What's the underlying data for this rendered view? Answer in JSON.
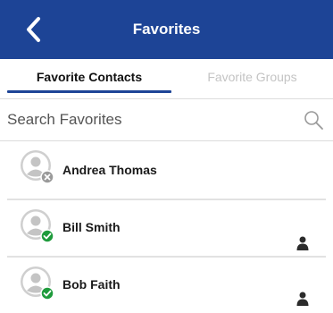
{
  "header": {
    "title": "Favorites",
    "back_icon": "chevron-left-icon"
  },
  "tabs": [
    {
      "label": "Favorite Contacts",
      "active": true
    },
    {
      "label": "Favorite Groups",
      "active": false
    }
  ],
  "search": {
    "placeholder": "Search Favorites",
    "value": ""
  },
  "contacts": [
    {
      "name": "Andrea Thomas",
      "status": "offline",
      "status_icon": "offline-x-icon",
      "show_person_icon": false
    },
    {
      "name": "Bill Smith",
      "status": "online",
      "status_icon": "online-check-icon",
      "show_person_icon": true
    },
    {
      "name": "Bob Faith",
      "status": "online",
      "status_icon": "online-check-icon",
      "show_person_icon": true
    }
  ],
  "colors": {
    "header_bg": "#1d4496",
    "online": "#1e9b3c",
    "offline": "#9a9a9a",
    "inactive_tab": "#c4c4c4"
  }
}
